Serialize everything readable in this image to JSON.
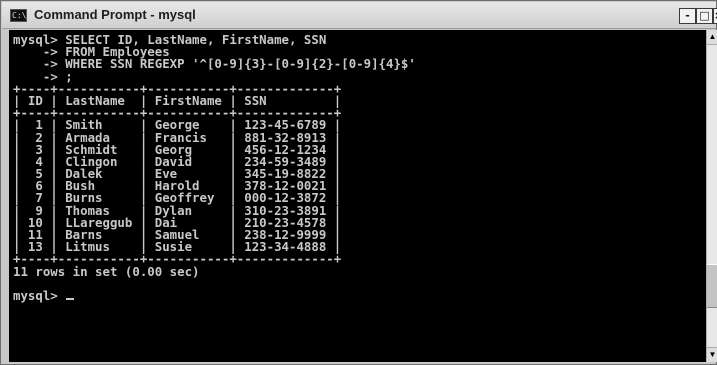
{
  "window": {
    "title": "Command Prompt - mysql",
    "controls": {
      "minimize": "-",
      "maximize": "□",
      "close": "×"
    }
  },
  "console": {
    "lines": [
      "mysql> SELECT ID, LastName, FirstName, SSN",
      "    -> FROM Employees",
      "    -> WHERE SSN REGEXP '^[0-9]{3}-[0-9]{2}-[0-9]{4}$'",
      "    -> ;",
      "+----+-----------+-----------+-------------+",
      "| ID | LastName  | FirstName | SSN         |",
      "+----+-----------+-----------+-------------+",
      "|  1 | Smith     | George    | 123-45-6789 |",
      "|  2 | Armada    | Francis   | 881-32-8913 |",
      "|  3 | Schmidt   | Georg     | 456-12-1234 |",
      "|  4 | Clingon   | David     | 234-59-3489 |",
      "|  5 | Dalek     | Eve       | 345-19-8822 |",
      "|  6 | Bush      | Harold    | 378-12-0021 |",
      "|  7 | Burns     | Geoffrey  | 000-12-3872 |",
      "|  9 | Thomas    | Dylan     | 310-23-3891 |",
      "| 10 | LLareggub | Dai       | 210-23-4578 |",
      "| 11 | Barns     | Samuel    | 238-12-9999 |",
      "| 13 | Litmus    | Susie     | 123-34-4888 |",
      "+----+-----------+-----------+-------------+",
      "11 rows in set (0.00 sec)",
      "",
      "mysql> "
    ]
  },
  "scrollbar": {
    "up_arrow": "▲",
    "down_arrow": "▼"
  }
}
